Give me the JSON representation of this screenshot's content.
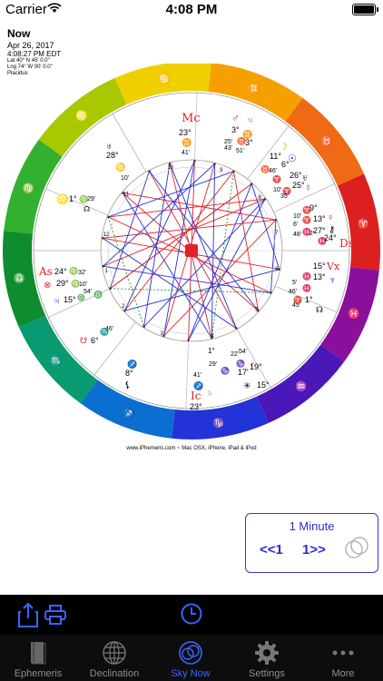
{
  "status_bar": {
    "carrier": "Carrier",
    "time": "4:08 PM"
  },
  "chart_info": {
    "title": "Now",
    "date": "Apr 26, 2017",
    "time": "4:08:27 PM EDT",
    "lat": "Lat 40° N 45' 0.0\"",
    "lng": "Lng 74° W 00' 0.0\"",
    "house_system": "Placidus"
  },
  "houses": {
    "mc": "Mc",
    "mc_deg": "23°",
    "mc_min": "41'",
    "ic": "Ic",
    "ic_deg": "23°",
    "ic_min": "41'",
    "as": "As",
    "as_deg": "24°",
    "as_min": "32'",
    "ds": "Ds",
    "ds_deg": "24°",
    "ds_min": "32'",
    "h11_deg": "28°",
    "h11_min": "10'",
    "h12_deg": "1°",
    "h12_min": "29'",
    "h2_deg": "15°",
    "h2_min": "54'",
    "h3_deg": "6°",
    "h3_min": "46'",
    "h5_deg": "1°",
    "h5_min": "29'",
    "h6_deg": "15°",
    "h6_min": "54'",
    "h8_deg": "6°",
    "h8_min": "46'",
    "h9_deg": "28°",
    "h9_min": "10'"
  },
  "planets": {
    "mars_deg": "3°",
    "mars_min": "25'",
    "saturn_deg": "3°",
    "saturn_min": "51'",
    "moon_deg": "11°",
    "moon_min": "43'",
    "sun_deg": "6°",
    "sun_min": "46'",
    "uranus_deg": "26°",
    "uranus_min": "10'",
    "venus_deg": "25°",
    "venus_min": "35'",
    "mercury_deg": "13°",
    "mercury_min": "6'",
    "chiron_deg": "27°",
    "chiron_min": "48'",
    "vertex_deg": "15°",
    "vertex_min": "5'",
    "neptune_deg": "13°",
    "neptune_min": "45'",
    "node_s_deg": "1°",
    "node_s_min": "29'",
    "pluto_deg": "19°",
    "pluto_min": "17'",
    "jupiter_deg": "15°",
    "jupiter_min": "54'",
    "fortune_deg": "29°",
    "fortune_min": "10'",
    "lilith_deg": "8°",
    "lilith_min": "23'",
    "pisces_deg": "9°",
    "node_n_deg": "1°",
    "node_n_min": "22'"
  },
  "house_numbers": [
    "1",
    "2",
    "3",
    "4",
    "5",
    "6",
    "7",
    "8",
    "9",
    "10",
    "11",
    "12"
  ],
  "colors": {
    "accent": "#2b2bd2",
    "tab_active": "#3c64ff",
    "tab_inactive": "#8e8e8e",
    "aspect_red": "#e0232a",
    "aspect_blue": "#2530d8",
    "aspect_green": "#1a9a1a"
  },
  "footer": "www.iPhemeris.com ~ Mac OSX, iPhone, iPad & iPod",
  "time_control": {
    "interval": "1 Minute",
    "back": "<<1",
    "forward": "1>>"
  },
  "toolbar_icons": [
    "share-icon",
    "print-icon",
    "clock-icon"
  ],
  "tabs": [
    {
      "label": "Ephemeris",
      "icon": "book-icon"
    },
    {
      "label": "Declination",
      "icon": "globe-icon"
    },
    {
      "label": "Sky Now",
      "icon": "sky-now-icon"
    },
    {
      "label": "Settings",
      "icon": "gear-icon"
    },
    {
      "label": "More",
      "icon": "more-icon"
    }
  ]
}
